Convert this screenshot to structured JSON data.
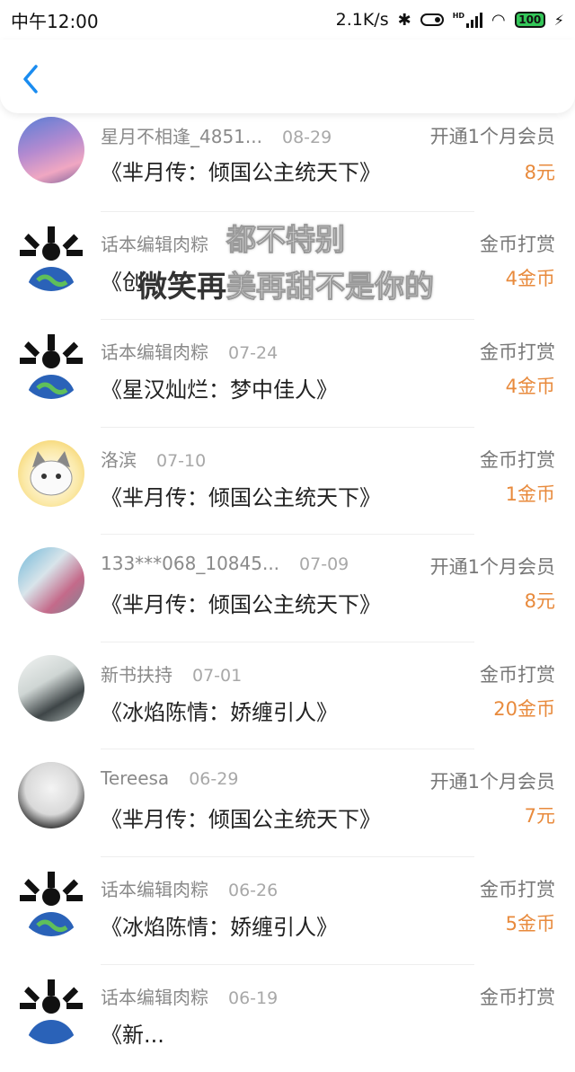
{
  "status": {
    "time": "中午12:00",
    "speed": "2.1K/s",
    "hd": "HD",
    "battery": "100"
  },
  "nav": {
    "back_icon": "chevron-left-icon"
  },
  "colors": {
    "accent": "#1a8cf0",
    "amount": "#e88a3c"
  },
  "rows": [
    {
      "name": "星月不相逢_4851...",
      "date": "08-29",
      "title": "《芈月传：倾国公主统天下》",
      "type": "开通1个月会员",
      "amount": "8元"
    },
    {
      "name": "话本编辑肉粽",
      "date": "",
      "title": "《创",
      "type": "金币打赏",
      "amount": "4金币"
    },
    {
      "name": "话本编辑肉粽",
      "date": "07-24",
      "title": "《星汉灿烂：梦中佳人》",
      "type": "金币打赏",
      "amount": "4金币"
    },
    {
      "name": "洛滨",
      "date": "07-10",
      "title": "《芈月传：倾国公主统天下》",
      "type": "金币打赏",
      "amount": "1金币"
    },
    {
      "name": "133***068_10845...",
      "date": "07-09",
      "title": "《芈月传：倾国公主统天下》",
      "type": "开通1个月会员",
      "amount": "8元"
    },
    {
      "name": "新书扶持",
      "date": "07-01",
      "title": "《冰焰陈情：娇缠引人》",
      "type": "金币打赏",
      "amount": "20金币"
    },
    {
      "name": "Tereesa",
      "date": "06-29",
      "title": "《芈月传：倾国公主统天下》",
      "type": "开通1个月会员",
      "amount": "7元"
    },
    {
      "name": "话本编辑肉粽",
      "date": "06-26",
      "title": "《冰焰陈情：娇缠引人》",
      "type": "金币打赏",
      "amount": "5金币"
    },
    {
      "name": "话本编辑肉粽",
      "date": "06-19",
      "title": "《新...",
      "type": "金币打赏",
      "amount": ""
    }
  ],
  "overlay": {
    "line1": "都不特别",
    "line2_green": "微笑再",
    "line2_rest": "美再甜不是你的"
  }
}
